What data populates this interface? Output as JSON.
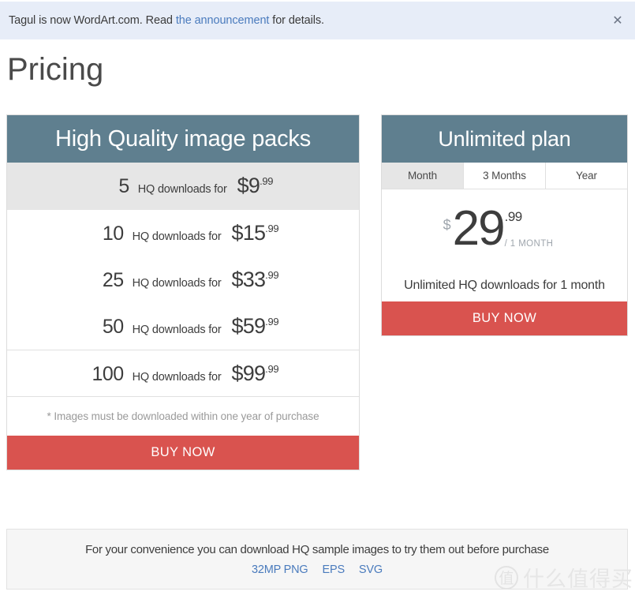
{
  "announcement": {
    "text_before": "Tagul is now WordArt.com. Read ",
    "link_text": "the announcement",
    "text_after": " for details.",
    "close_icon": "close-icon",
    "background_color": "#e7edf8",
    "link_color": "#4a7bbd"
  },
  "page": {
    "title": "Pricing"
  },
  "packs_panel": {
    "header": "High Quality image packs",
    "label": "HQ downloads for",
    "rows": [
      {
        "qty": "5",
        "label": "HQ downloads for",
        "dollars": "$9",
        "cents": ".99"
      },
      {
        "qty": "10",
        "label": "HQ downloads for",
        "dollars": "$15",
        "cents": ".99"
      },
      {
        "qty": "25",
        "label": "HQ downloads for",
        "dollars": "$33",
        "cents": ".99"
      },
      {
        "qty": "50",
        "label": "HQ downloads for",
        "dollars": "$59",
        "cents": ".99"
      },
      {
        "qty": "100",
        "label": "HQ downloads for",
        "dollars": "$99",
        "cents": ".99"
      }
    ],
    "footnote": "* Images must be downloaded within one year of purchase",
    "buy_label": "BUY NOW"
  },
  "unlimited_panel": {
    "header": "Unlimited plan",
    "tabs": [
      {
        "label": "Month",
        "active": true
      },
      {
        "label": "3 Months",
        "active": false
      },
      {
        "label": "Year",
        "active": false
      }
    ],
    "price": {
      "currency": "$",
      "amount": "29",
      "cents": ".99",
      "period": "/ 1 MONTH"
    },
    "description": "Unlimited HQ downloads for 1 month",
    "buy_label": "BUY NOW"
  },
  "footer": {
    "text": "For your convenience you can download HQ sample images to try them out before purchase",
    "links": [
      "32MP PNG",
      "EPS",
      "SVG"
    ]
  },
  "watermark": {
    "badge": "值",
    "text": "什么值得买"
  },
  "colors": {
    "panel_header_teal": "#5f7f8f",
    "buy_button_red": "#d9534f",
    "row_highlight": "#e6e6e6",
    "link_blue": "#4a7bbd",
    "footer_bg": "#f6f6f6"
  }
}
